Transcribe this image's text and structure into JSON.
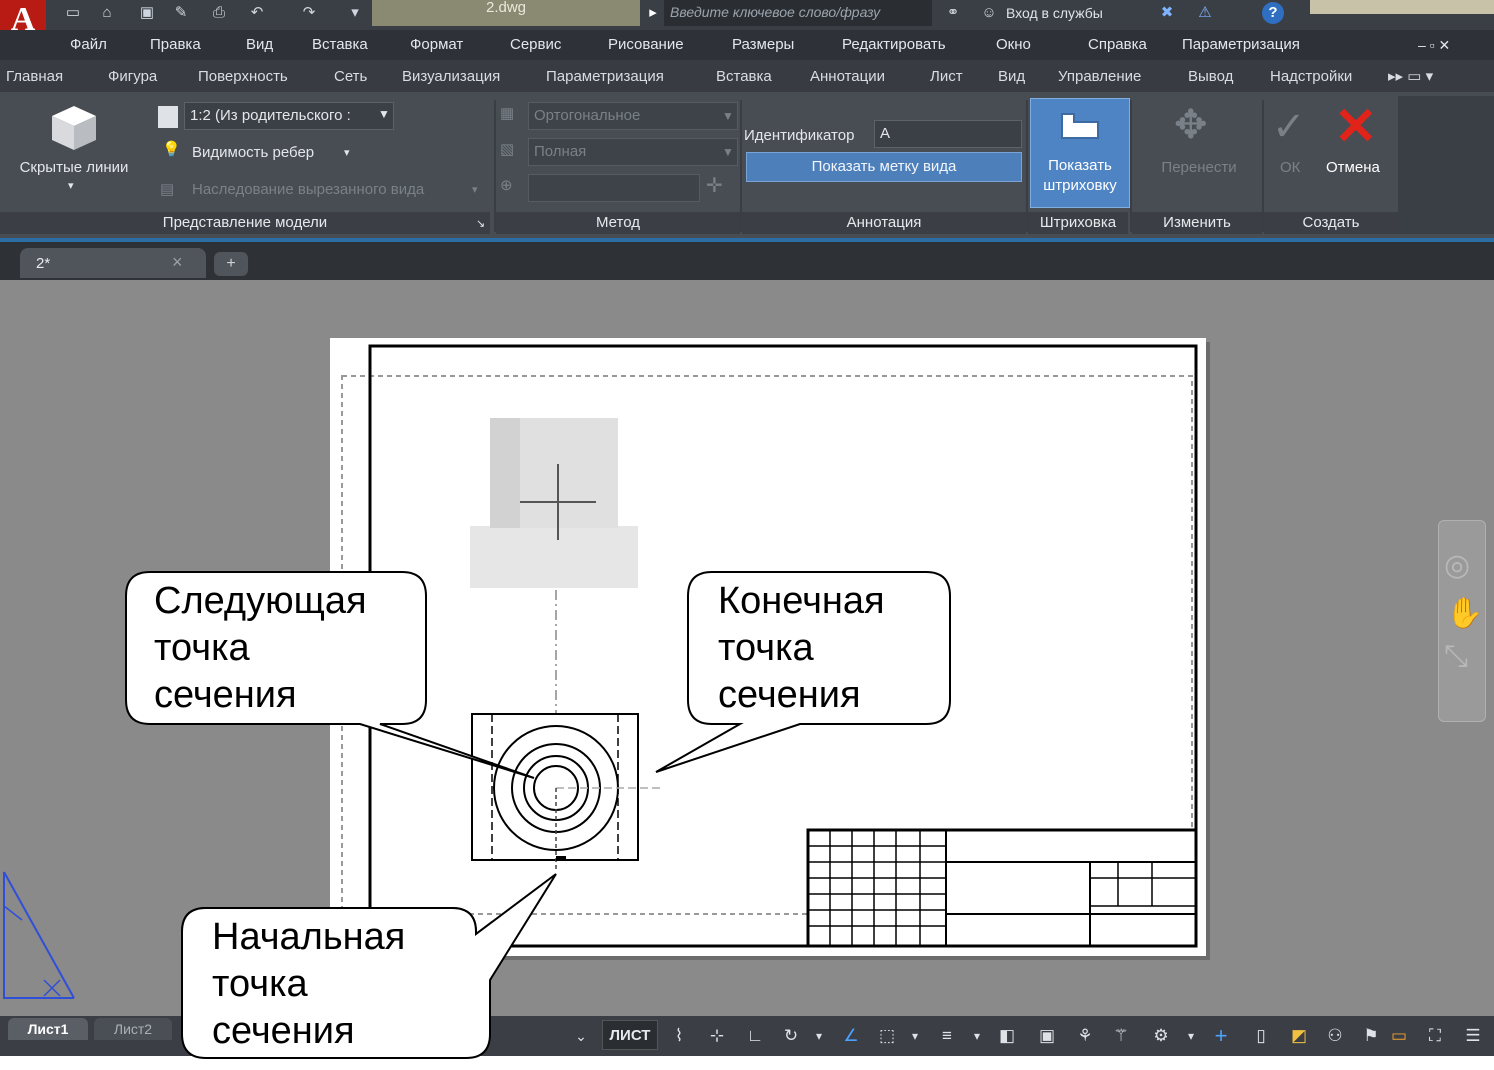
{
  "titlebar": {
    "file_name": "2.dwg",
    "search_placeholder": "Введите ключевое слово/фразу",
    "sign_in": "Вход в службы",
    "help": "?"
  },
  "app_logo": "A",
  "menu": [
    "Файл",
    "Правка",
    "Вид",
    "Вставка",
    "Формат",
    "Сервис",
    "Рисование",
    "Размеры",
    "Редактировать",
    "Окно",
    "Справка",
    "Параметризация"
  ],
  "ribbon_tabs": [
    "Главная",
    "Фигура",
    "Поверхность",
    "Сеть",
    "Визуализация",
    "Параметризация",
    "Вставка",
    "Аннотации",
    "Лист",
    "Вид",
    "Управление",
    "Вывод",
    "Надстройки"
  ],
  "ribbon": {
    "hidden_lines": "Скрытые линии",
    "scale": "1:2 (Из родительского :",
    "edge_visibility": "Видимость ребер",
    "inherit_cut": "Наследование вырезанного вида",
    "projection": "Ортогональное",
    "method_type": "Полная",
    "identifier_label": "Идентификатор",
    "identifier_value": "A",
    "show_view_label": "Показать метку вида",
    "show_hatch": "Показать штриховку",
    "move": "Перенести",
    "ok": "ОК",
    "cancel": "Отмена",
    "panels": {
      "model_view": "Представление модели",
      "method": "Метод",
      "annotation": "Аннотация",
      "hatch": "Штриховка",
      "modify": "Изменить",
      "create": "Создать"
    }
  },
  "doc_tab": {
    "name": "2*",
    "close": "×",
    "new": "+"
  },
  "layout_tabs": [
    "Лист1",
    "Лист2"
  ],
  "status": {
    "paper": "ЛИСТ"
  },
  "callouts": {
    "next_point": [
      "Следующая",
      "точка",
      "сечения"
    ],
    "end_point": [
      "Конечная",
      "точка",
      "сечения"
    ],
    "start_point": [
      "Начальная",
      "точка",
      "сечения"
    ]
  },
  "colors": {
    "ribbon_bg": "#484d54",
    "accent_blue": "#4d7fba",
    "cancel_red": "#e2231a",
    "canvas_bg": "#8a8a8a"
  }
}
